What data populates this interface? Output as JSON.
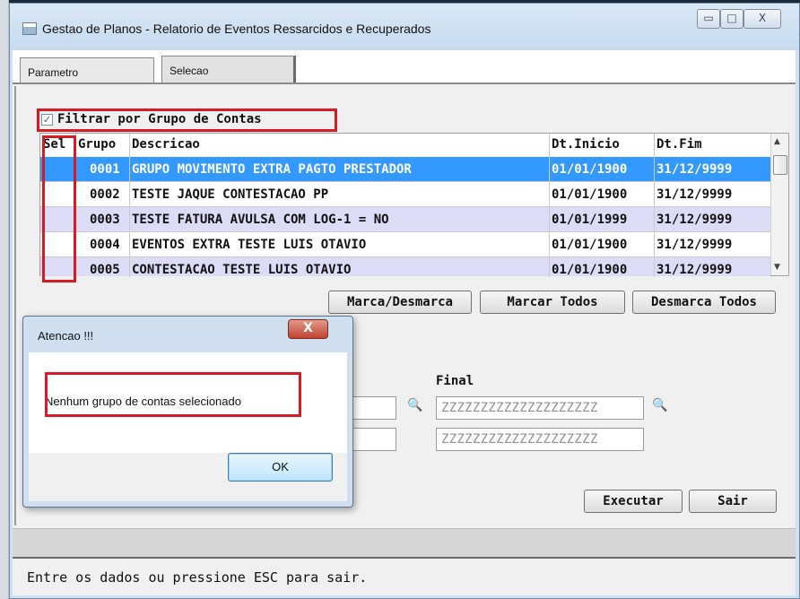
{
  "window": {
    "title": "Gestao de Planos - Relatorio de Eventos Ressarcidos e Recuperados",
    "controls": {
      "minimize": "▭",
      "maximize": "□",
      "close": "X"
    }
  },
  "tabs": [
    {
      "label": "Parametro",
      "active": false
    },
    {
      "label": "Selecao",
      "active": true
    }
  ],
  "filter": {
    "label": "Filtrar por Grupo de Contas",
    "checked": true,
    "check_glyph": "✓"
  },
  "grid": {
    "columns": [
      "Sel",
      "Grupo",
      "Descricao",
      "Dt.Inicio",
      "Dt.Fim"
    ],
    "rows": [
      {
        "sel": "",
        "grupo": "0001",
        "descricao": "GRUPO MOVIMENTO EXTRA PAGTO PRESTADOR",
        "dt_inicio": "01/01/1900",
        "dt_fim": "31/12/9999",
        "selected": true
      },
      {
        "sel": "",
        "grupo": "0002",
        "descricao": "TESTE JAQUE CONTESTACAO PP",
        "dt_inicio": "01/01/1900",
        "dt_fim": "31/12/9999",
        "selected": false
      },
      {
        "sel": "",
        "grupo": "0003",
        "descricao": "TESTE FATURA AVULSA COM LOG-1 = NO",
        "dt_inicio": "01/01/1999",
        "dt_fim": "31/12/9999",
        "selected": false
      },
      {
        "sel": "",
        "grupo": "0004",
        "descricao": "EVENTOS EXTRA TESTE LUIS OTAVIO",
        "dt_inicio": "01/01/1900",
        "dt_fim": "31/12/9999",
        "selected": false
      },
      {
        "sel": "",
        "grupo": "0005",
        "descricao": "CONTESTACAO TESTE LUIS OTAVIO",
        "dt_inicio": "01/01/1900",
        "dt_fim": "31/12/9999",
        "selected": false
      }
    ],
    "scroll_up": "▲",
    "scroll_down": "▼"
  },
  "buttons": {
    "marca_desmarca": "Marca/Desmarca",
    "marcar_todos": "Marcar Todos",
    "desmarca_todos": "Desmarca Todos",
    "executar": "Executar",
    "sair": "Sair"
  },
  "range": {
    "final_label": "Final",
    "final_value_1": "ZZZZZZZZZZZZZZZZZZZZ",
    "final_value_2": "ZZZZZZZZZZZZZZZZZZZZ",
    "zoom_icon": "🔍"
  },
  "status": {
    "text": "Entre os dados ou pressione ESC para sair."
  },
  "dialog": {
    "title": "Atencao !!!",
    "close": "X",
    "message": "Nenhum grupo de contas selecionado",
    "ok": "OK"
  },
  "colors": {
    "selected_row": "#3399ff",
    "alt_row": "#dcdcf7",
    "highlight": "#d81b23",
    "grid_text": "#111111"
  }
}
